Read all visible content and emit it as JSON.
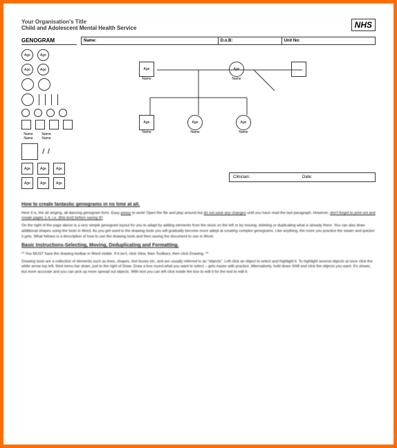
{
  "header": {
    "org": "Your Organisation's Title",
    "sub": "Child and Adolescent Mental Health Service",
    "nhs": "NHS"
  },
  "bar": {
    "title": "GENOGRAM",
    "name": "Name:",
    "dob": "D.o.B:",
    "unit": "Unit No:"
  },
  "pal": {
    "age": "Age",
    "name": "Name"
  },
  "diagram": {
    "age": "Age",
    "name": "Name"
  },
  "footer": {
    "clinician": "Clinician:",
    "date": "Date:"
  },
  "instr": {
    "h1": "How to create fantastic genograms in no time at all.",
    "p1a": "Here it is, the all singing, all dancing genogram form. Easy-",
    "p1b": "peasy",
    "p1c": " to work! Open the file and play around but ",
    "p1d": "do not save any changes",
    "p1e": " until you have read the last paragraph. However, ",
    "p1f": "don't forget to print out and create pages 1-4, i.e. (this text) before saving it!!",
    "p2": "On the right of the page above is a very simple genogram layout for you to adapt by adding elements from the stock on the left or by moving, deleting or duplicating what is already there. You can also draw additional shapes using the tools in Word. As you get used to the drawing tools you will gradually become more adept at creating complex genograms. Like anything, the more you practice the easier and quicker it gets. What follows is a description of how to use the drawing tools and then saving the document to use in Word.",
    "h2": "Basic Instructions-Selecting, Moving, Deduplicating and Formatting.",
    "p3": "** You MUST have the drawing toolbar in Word visible. If it isn't, click View, then Toolbars, then click Drawing. **",
    "p4": "Drawing tools are a collection of elements such as lines, shapes, text boxes etc, and are usually referred to as \"objects\". Left click an object to select and highlight it. To highlight several objects at once click the white arrow top left, third menu bar down, just to the right of Draw. Draw a box round what you want to select – gets easier with practice. Alternatively, hold down Shift and click the objects you want. It's slower, but more accurate and you can pick up more spread out objects. With text you can left click inside the box to edit it for the text to edit it."
  }
}
